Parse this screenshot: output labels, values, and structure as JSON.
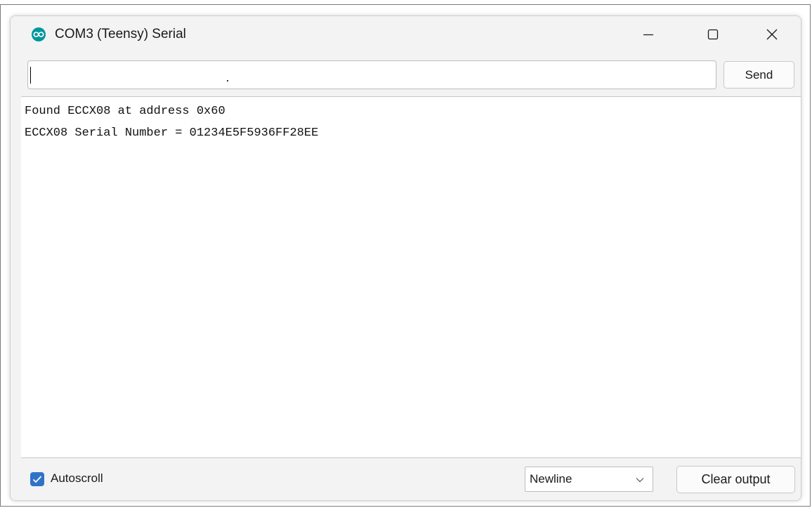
{
  "window": {
    "title": "COM3 (Teensy) Serial",
    "app_icon": "arduino-icon",
    "controls": [
      "minimize-icon",
      "maximize-icon",
      "close-icon"
    ]
  },
  "input": {
    "value": "",
    "send_label": "Send"
  },
  "output": {
    "lines": [
      "Found ECCX08 at address 0x60",
      "ECCX08 Serial Number = 01234E5F5936FF28EE"
    ]
  },
  "footer": {
    "autoscroll_label": "Autoscroll",
    "autoscroll_checked": true,
    "line_ending": "Newline",
    "clear_label": "Clear output"
  },
  "colors": {
    "accent": "#2f73c9",
    "arduino_teal": "#00979c"
  }
}
